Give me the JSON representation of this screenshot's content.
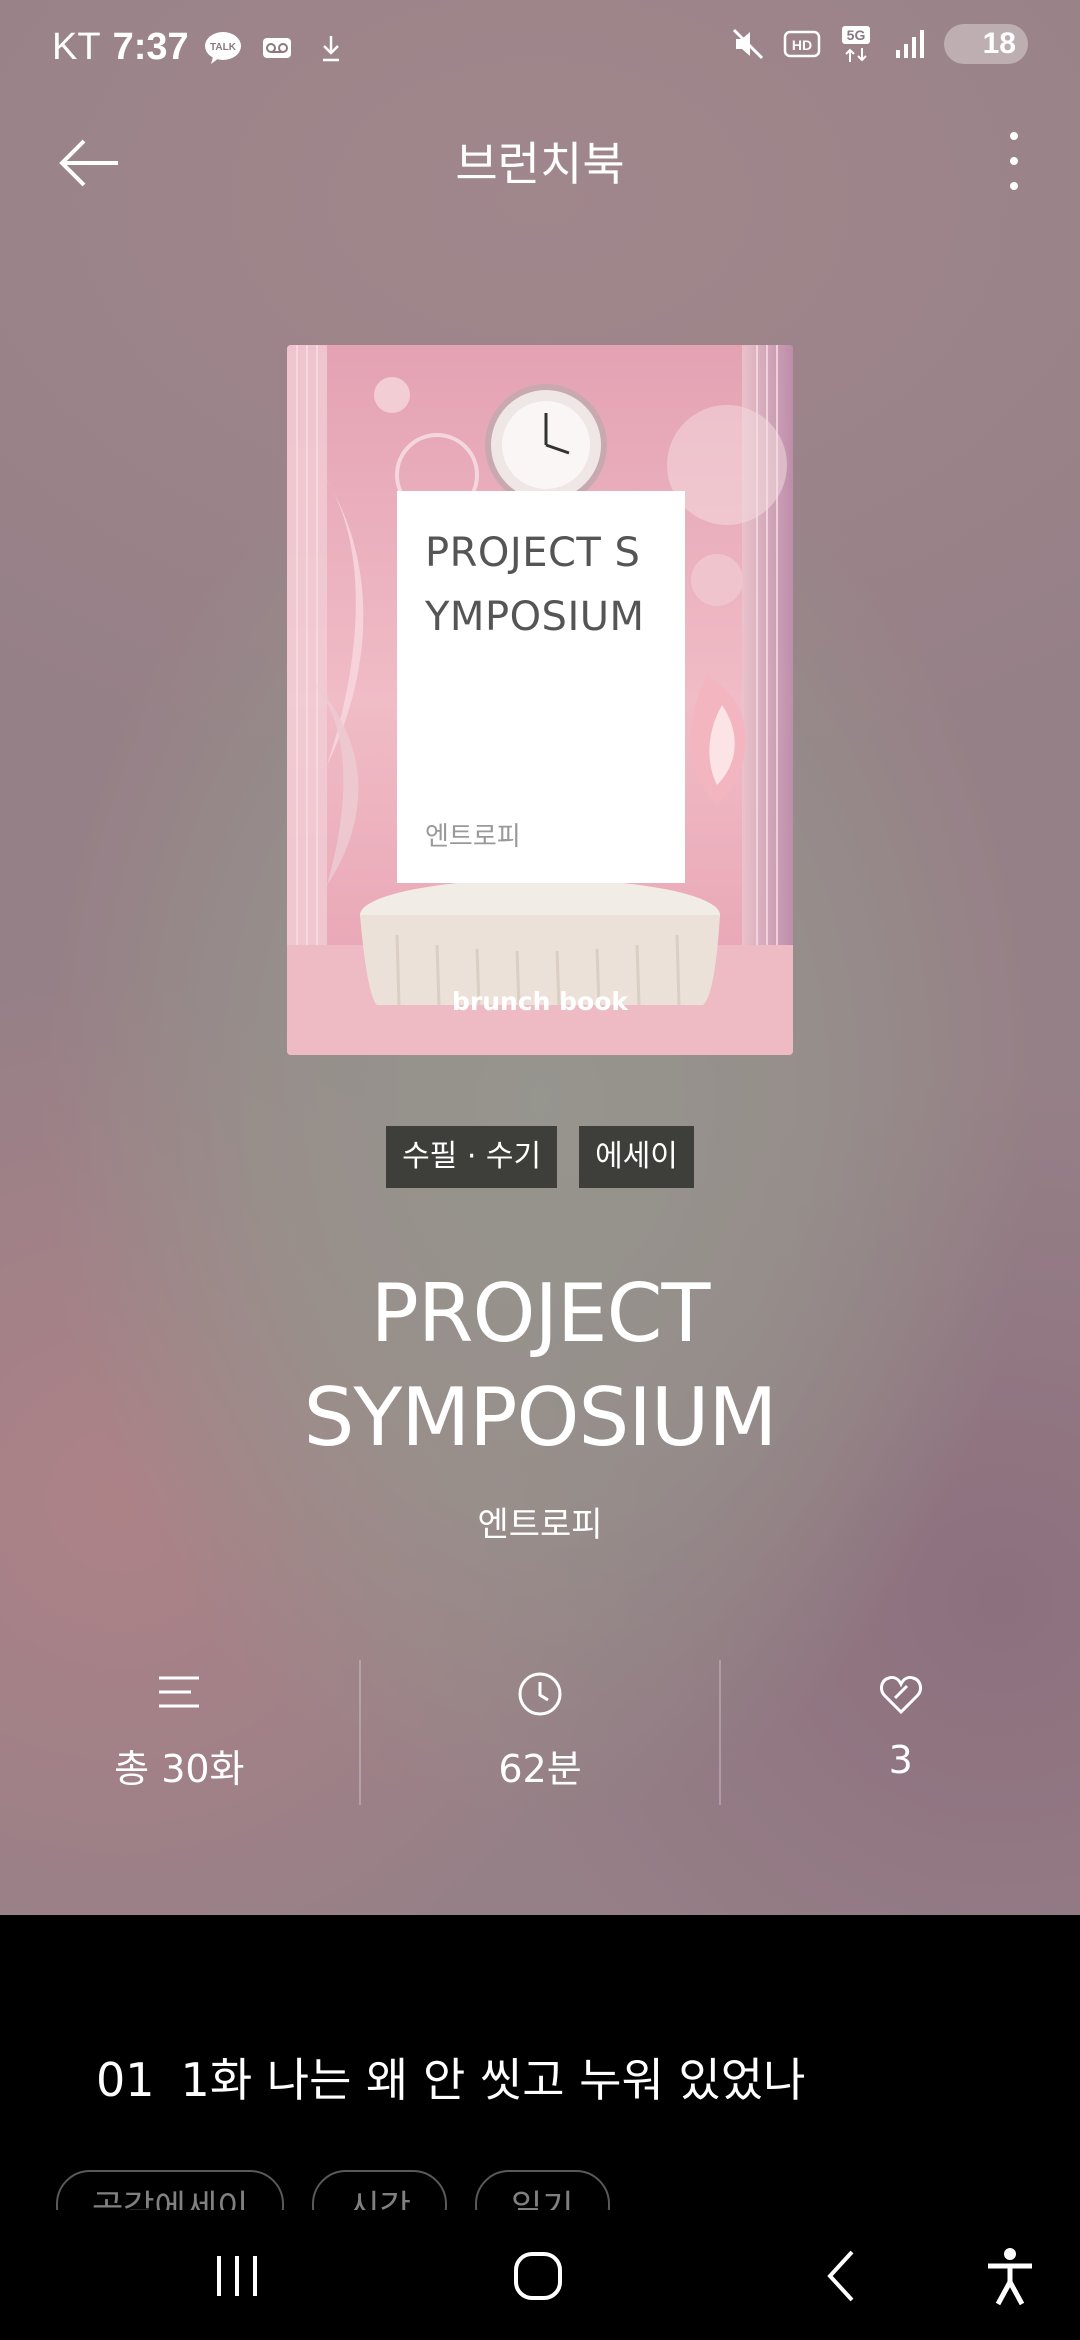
{
  "status_bar": {
    "carrier": "KT",
    "time": "7:37",
    "battery": "18",
    "icons": [
      "kakaotalk-icon",
      "voicemail-icon",
      "download-icon",
      "mute-icon",
      "hd-icon",
      "5g-icon",
      "signal-icon",
      "battery-icon"
    ]
  },
  "nav": {
    "title": "브런치북",
    "icons": [
      "back-arrow-icon",
      "more-vertical-icon"
    ]
  },
  "cover": {
    "title": "PROJECT SYMPOSIUM",
    "author": "엔트로피",
    "brand": "brunch book"
  },
  "tags": [
    "수필 · 수기",
    "에세이"
  ],
  "book": {
    "title_line1": "PROJECT",
    "title_line2": "SYMPOSIUM",
    "author": "엔트로피"
  },
  "stats": {
    "episodes": "총 30화",
    "minutes": "62분",
    "likes": "3",
    "icons": [
      "list-icon",
      "clock-icon",
      "heart-icon"
    ]
  },
  "episode": {
    "number": "01",
    "title": "1화 나는 왜 안 씻고 누워 있었나"
  },
  "chips": [
    "공감에세이",
    "시간",
    "일기"
  ],
  "colors": {
    "tag_bg": "#3e3e3a",
    "list_bg": "#000000"
  }
}
